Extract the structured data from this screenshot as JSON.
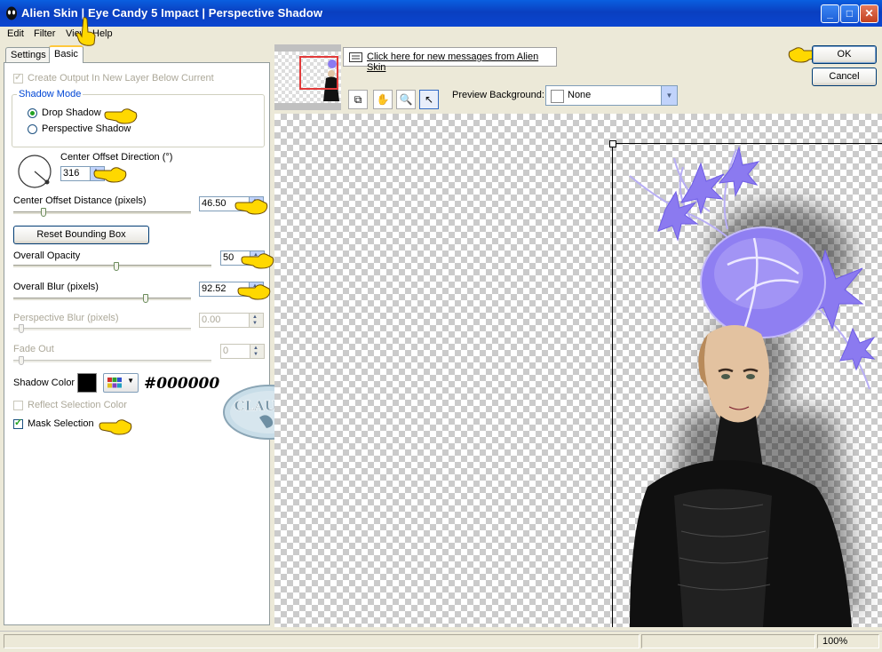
{
  "window": {
    "title": "Alien Skin  |  Eye Candy 5 Impact  |  Perspective Shadow",
    "minimize": "_",
    "maximize": "□",
    "close": "✕"
  },
  "menu": [
    "Edit",
    "Filter",
    "View",
    "Help"
  ],
  "tabs": [
    "Settings",
    "Basic"
  ],
  "basic": {
    "create_output_label": "Create Output In New Layer Below Current",
    "shadow_mode_label": "Shadow Mode",
    "drop_shadow_label": "Drop Shadow",
    "perspective_shadow_label": "Perspective Shadow",
    "center_offset_direction_label": "Center Offset Direction (°)",
    "center_offset_direction_value": "316",
    "center_offset_distance_label": "Center Offset Distance (pixels)",
    "center_offset_distance_value": "46.50",
    "reset_bounding_box_label": "Reset Bounding Box",
    "overall_opacity_label": "Overall Opacity",
    "overall_opacity_value": "50",
    "overall_blur_label": "Overall Blur (pixels)",
    "overall_blur_value": "92.52",
    "perspective_blur_label": "Perspective Blur (pixels)",
    "perspective_blur_value": "0.00",
    "fade_out_label": "Fade Out",
    "fade_out_value": "0",
    "shadow_color_label": "Shadow Color",
    "shadow_color_hex": "#000000",
    "reflect_selection_color_label": "Reflect Selection Color",
    "mask_selection_label": "Mask Selection"
  },
  "watermark_text": "CLAUDIA",
  "messages_link": "Click here for new messages from Alien Skin",
  "preview_background_label": "Preview Background:",
  "preview_background_value": "None",
  "ok_label": "OK",
  "cancel_label": "Cancel",
  "status_zoom": "100%",
  "colors": {
    "title_bar": "#0a4bd0",
    "accent_hand": "#ffd800",
    "shadow_color": "#000000",
    "thumb_frame": "#e23a3a",
    "flower": "#8b7af0"
  }
}
